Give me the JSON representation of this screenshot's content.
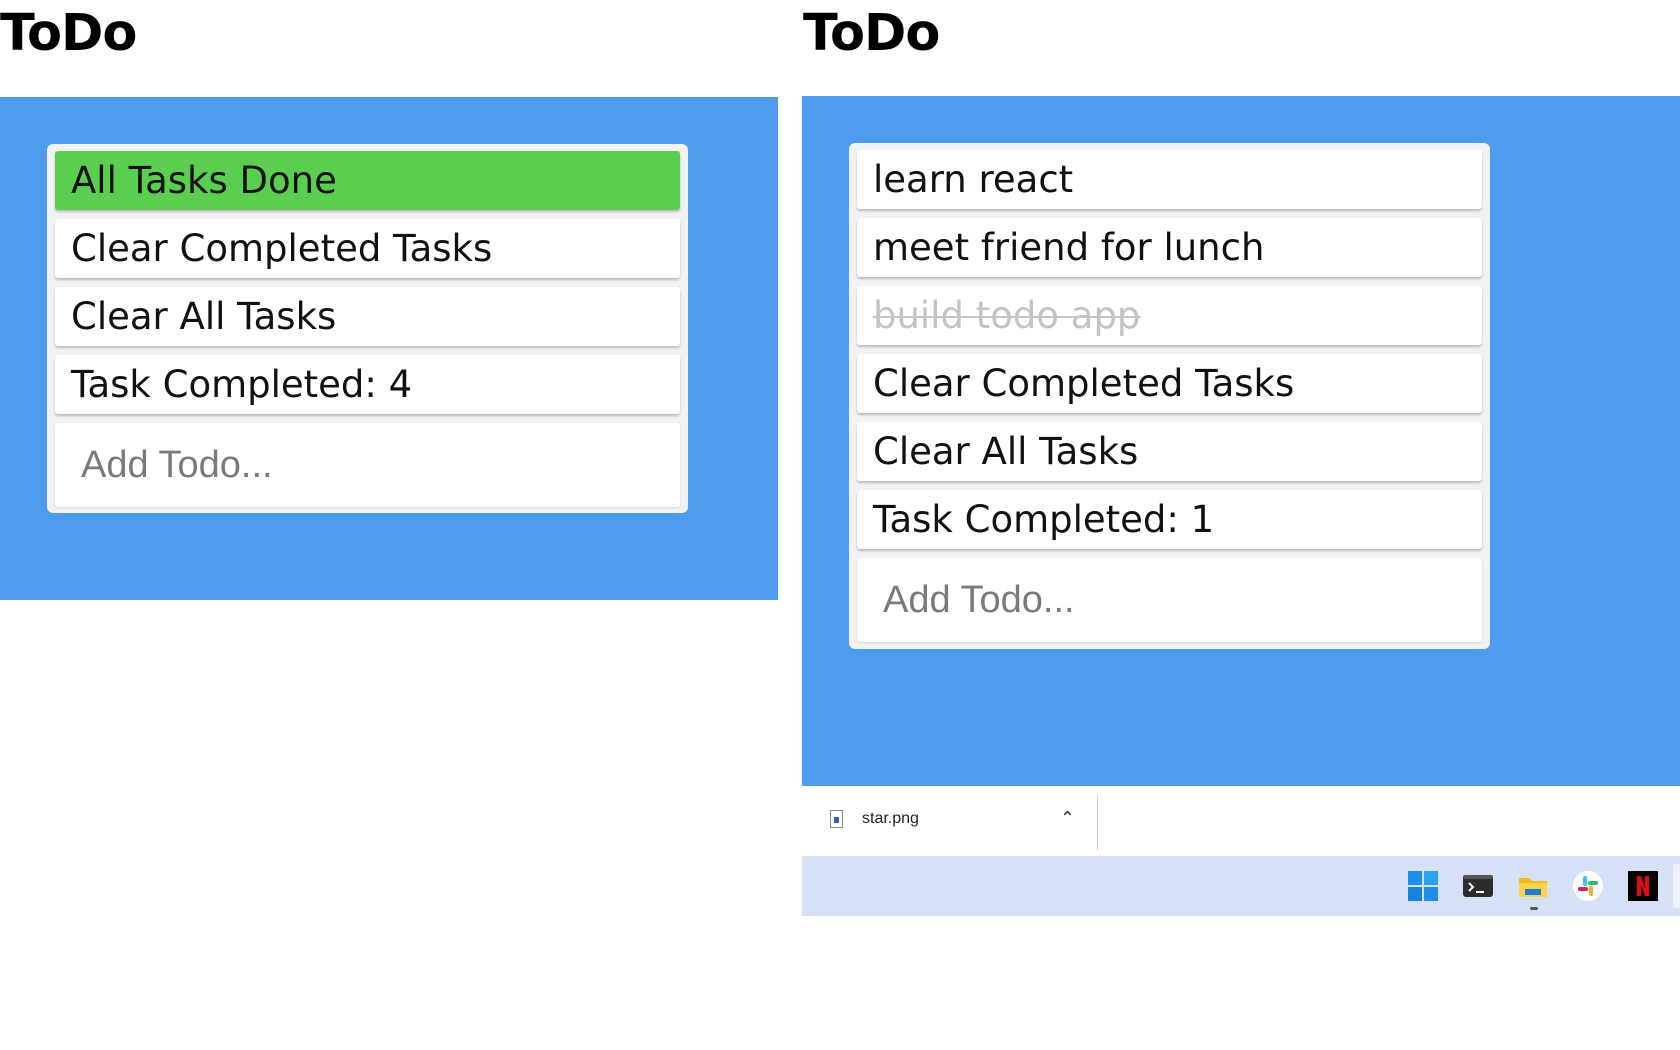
{
  "left_window": {
    "title": "ToDo",
    "items": [
      {
        "label": "All Tasks Done"
      },
      {
        "label": "Clear Completed Tasks"
      },
      {
        "label": "Clear All Tasks"
      },
      {
        "label": "Task Completed: 4"
      }
    ],
    "add_placeholder": "Add Todo..."
  },
  "right_window": {
    "title": "ToDo",
    "todos": [
      {
        "label": "learn react",
        "completed": false
      },
      {
        "label": "meet friend for lunch",
        "completed": false
      },
      {
        "label": "build todo app",
        "completed": true
      }
    ],
    "clear_completed_label": "Clear Completed Tasks",
    "clear_all_label": "Clear All Tasks",
    "count_label": "Task Completed: 1",
    "add_placeholder": "Add Todo..."
  },
  "download_bar": {
    "file_name": "star.png",
    "chevron_icon": "chevron-up-icon"
  },
  "taskbar": {
    "icons": [
      "windows-start-icon",
      "terminal-icon",
      "file-explorer-icon",
      "slack-icon",
      "netflix-icon"
    ]
  },
  "colors": {
    "panel_blue": "#4d9ced",
    "done_green": "#5ace4f",
    "taskbar_bg": "#d6e1f8",
    "netflix_red": "#e50914"
  }
}
